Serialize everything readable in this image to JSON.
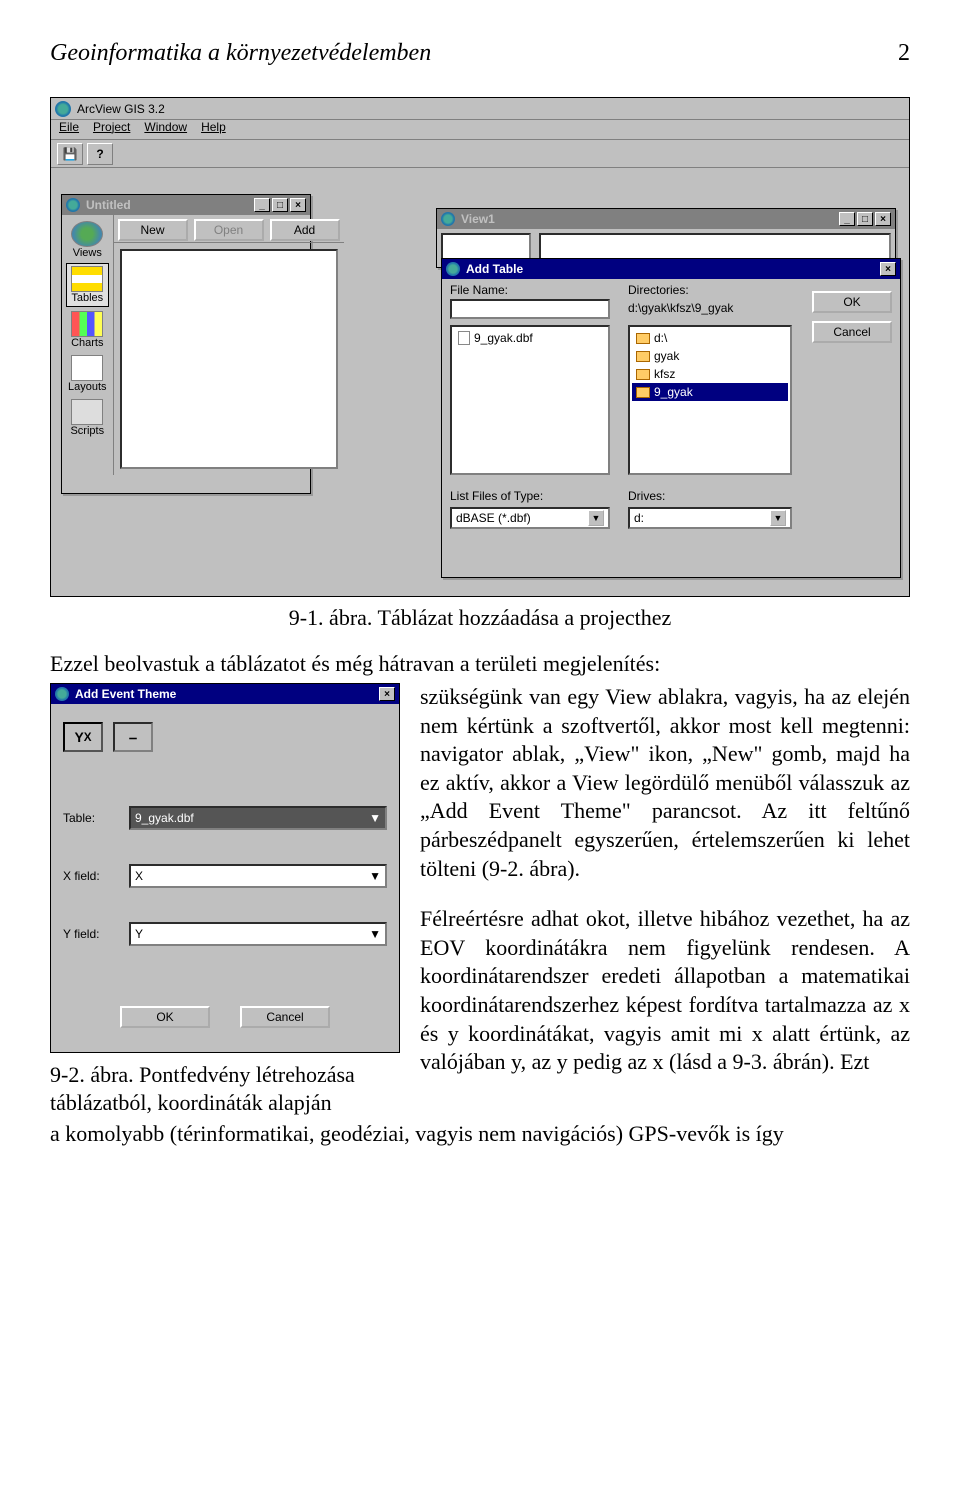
{
  "header": {
    "title": "Geoinformatika a környezetvédelemben",
    "page": "2"
  },
  "app": {
    "title": "ArcView GIS 3.2",
    "menu": [
      "Eile",
      "Project",
      "Window",
      "Help"
    ]
  },
  "untitled_win": {
    "title": "Untitled",
    "buttons": {
      "new": "New",
      "open": "Open",
      "add": "Add"
    },
    "items": [
      "Views",
      "Tables",
      "Charts",
      "Layouts",
      "Scripts"
    ]
  },
  "view_win": {
    "title": "View1"
  },
  "dialog": {
    "title": "Add Table",
    "file_name_label": "File Name:",
    "directories_label": "Directories:",
    "dir_path": "d:\\gyak\\kfsz\\9_gyak",
    "file_item": "9_gyak.dbf",
    "folders": [
      "d:\\",
      "gyak",
      "kfsz",
      "9_gyak"
    ],
    "list_type_label": "List Files of Type:",
    "list_type_value": "dBASE (*.dbf)",
    "drives_label": "Drives:",
    "drives_value": "d:",
    "ok": "OK",
    "cancel": "Cancel"
  },
  "caption1": "9-1. ábra. Táblázat hozzáadása a projecthez",
  "body": {
    "p1a": "Ezzel beolvastuk a táblázatot és még hátravan a területi megjelenítés:",
    "p1b": "szükségünk van egy View ablakra, vagyis, ha az elején nem kértünk a szoftvertől, akkor most kell megtenni: navigator ablak, „View\" ikon, „New\" gomb, majd ha ez aktív, akkor a View legördülő menüből válasszuk az „Add Event Theme\" parancsot. Az itt feltűnő párbeszédpanelt egyszerűen, értelemszerűen ki lehet tölteni (9-2. ábra).",
    "p2": "Félreértésre adhat okot, illetve hibához vezethet, ha az EOV koordinátákra nem figyelünk rendesen. A koordinátarendszer eredeti állapotban a matematikai koordinátarendszerhez képest fordítva tartalmazza az x és y koordinátákat, vagyis amit mi x alatt értünk, az valójában y, az y pedig az x (lásd a 9-3. ábrán). Ezt",
    "p3": "a komolyabb (térinformatikai, geodéziai, vagyis nem navigációs) GPS-vevők is így"
  },
  "add_event": {
    "title": "Add Event Theme",
    "table_label": "Table:",
    "table_value": "9_gyak.dbf",
    "x_label": "X field:",
    "x_value": "X",
    "y_label": "Y field:",
    "y_value": "Y",
    "ok": "OK",
    "cancel": "Cancel"
  },
  "caption2": "9-2. ábra. Pontfedvény létrehozása táblázatból, koordináták alapján"
}
